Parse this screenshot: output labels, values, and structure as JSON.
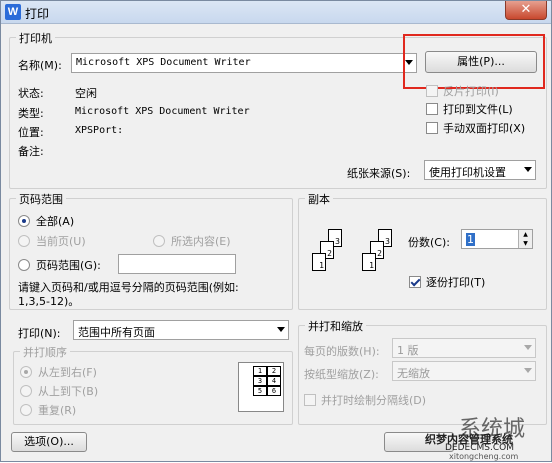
{
  "window": {
    "title": "打印",
    "icon": "W",
    "close": "✕"
  },
  "printer": {
    "group_label": "打印机",
    "name_label": "名称(M):",
    "name_value": "Microsoft XPS Document Writer",
    "properties_button": "属性(P)...",
    "status_label": "状态:",
    "status_value": "空闲",
    "type_label": "类型:",
    "type_value": "Microsoft XPS Document Writer",
    "location_label": "位置:",
    "location_value": "XPSPort:",
    "comment_label": "备注:",
    "reverse_print": "反片打印(I)",
    "print_to_file": "打印到文件(L)",
    "manual_duplex": "手动双面打印(X)",
    "paper_source_label": "纸张来源(S):",
    "paper_source_value": "使用打印机设置"
  },
  "page_range": {
    "group_label": "页码范围",
    "all": "全部(A)",
    "current": "当前页(U)",
    "selection": "所选内容(E)",
    "pages": "页码范围(G):",
    "pages_value": "",
    "hint_line1": "请键入页码和/或用逗号分隔的页码范围(例如:",
    "hint_line2": "1,3,5-12)。"
  },
  "copies": {
    "group_label": "副本",
    "count_label": "份数(C):",
    "count_value": "1",
    "collate": "逐份打印(T)",
    "page_numbers": [
      "1",
      "2",
      "3"
    ]
  },
  "print_what": {
    "label": "打印(N):",
    "value": "范围中所有页面"
  },
  "order": {
    "group_label": "并打顺序",
    "left_to_right": "从左到右(F)",
    "top_to_bottom": "从上到下(B)",
    "repeat": "重复(R)",
    "grid": [
      "1",
      "2",
      "3",
      "4",
      "5",
      "6"
    ]
  },
  "zoom": {
    "group_label": "并打和缩放",
    "pages_per_sheet_label": "每页的版数(H):",
    "pages_per_sheet_value": "1 版",
    "scale_label": "按纸型缩放(Z):",
    "scale_value": "无缩放",
    "draw_lines": "并打时绘制分隔线(D)"
  },
  "footer": {
    "options_button": "选项(O)..."
  },
  "watermark": {
    "line1": "系统城",
    "line2": "织梦内容管理系统",
    "line3": "DEDECMS.COM",
    "site": "xitongcheng.com"
  }
}
